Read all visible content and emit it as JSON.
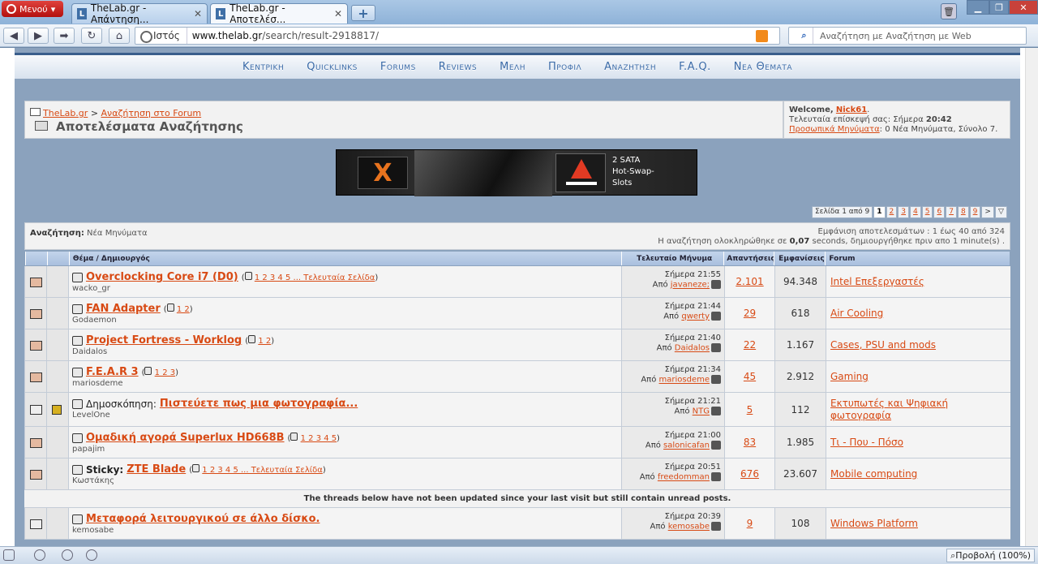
{
  "browser": {
    "menu_label": "Μενού",
    "tabs": [
      {
        "label": "TheLab.gr - Απάντηση..."
      },
      {
        "label": "TheLab.gr - Αποτελέσ..."
      }
    ],
    "address_label": "Ιστός",
    "url_host": "www.thelab.gr",
    "url_path": "/search/result-2918817/",
    "search_placeholder": "Αναζήτηση με Αναζήτηση με Web",
    "zoom": "Προβολή (100%)"
  },
  "nav": [
    "Κεντρικη",
    "Quicklinks",
    "Forums",
    "Reviews",
    "Μελη",
    "Προφιλ",
    "Αναζητηση",
    "F.A.Q.",
    "Νεα Θεματα"
  ],
  "breadcrumb": {
    "site": "TheLab.gr",
    "sep": ">",
    "section": "Αναζήτηση στο Forum",
    "title": "Αποτελέσματα Αναζήτησης"
  },
  "welcome": {
    "prefix": "Welcome,",
    "user": "Nick61",
    "suffix": ".",
    "last_visit": "Τελευταία επίσκεψή σας: Σήμερα",
    "last_time": "20:42",
    "pm_link": "Προσωπικά Μηνύματα",
    "pm_info": ": 0 Νέα Μηνύματα, Σύνολο 7."
  },
  "banner": {
    "text1": "2 SATA",
    "text2": "Hot-Swap-",
    "text3": "Slots"
  },
  "pager": {
    "label": "Σελίδα 1 από 9",
    "pages": [
      "1",
      "2",
      "3",
      "4",
      "5",
      "6",
      "7",
      "8",
      "9"
    ],
    "next": ">"
  },
  "search_info": {
    "label": "Αναζήτηση:",
    "value": "Νέα Μηνύματα",
    "line1": "Εμφάνιση αποτελεσμάτων : 1 έως 40 από 324",
    "line2a": "Η αναζήτηση ολοκληρώθηκε σε",
    "line2b": "0,07",
    "line2c": "seconds, δημιουργήθηκε πριν απο 1 minute(s) ."
  },
  "columns": {
    "topic": "Θέμα / Δημιουργός",
    "last": "Τελευταίο Μήνυμα",
    "replies": "Απαντήσεις",
    "views": "Εμφανίσεις",
    "forum": "Forum"
  },
  "rows": [
    {
      "prefix": "",
      "title": "Overclocking Core i7 (D0)",
      "pages": "1 2 3 4 5 ... Τελευταία Σελίδα",
      "author": "wacko_gr",
      "time": "Σήμερα 21:55",
      "by": "Από",
      "last_user": "javaneze;",
      "replies": "2.101",
      "views": "94.348",
      "forum": "Intel Επεξεργαστές"
    },
    {
      "prefix": "",
      "title": "FAN Adapter",
      "pages": "1 2",
      "author": "Godaemon",
      "time": "Σήμερα 21:44",
      "by": "Από",
      "last_user": "qwerty",
      "replies": "29",
      "views": "618",
      "forum": "Air Cooling"
    },
    {
      "prefix": "",
      "title": "Project Fortress - Worklog",
      "pages": "1 2",
      "author": "Daidalos",
      "time": "Σήμερα 21:40",
      "by": "Από",
      "last_user": "Daidalos",
      "replies": "22",
      "views": "1.167",
      "forum": "Cases, PSU and mods"
    },
    {
      "prefix": "",
      "title": "F.E.A.R 3",
      "pages": "1 2 3",
      "author": "mariosdeme",
      "time": "Σήμερα 21:34",
      "by": "Από",
      "last_user": "mariosdeme",
      "replies": "45",
      "views": "2.912",
      "forum": "Gaming"
    },
    {
      "prefix": "Δημοσκόπηση:",
      "title": "Πιστεύετε πως μια φωτογραφία...",
      "pages": "",
      "author": "LevelOne",
      "time": "Σήμερα 21:21",
      "by": "Από",
      "last_user": "NTG",
      "replies": "5",
      "views": "112",
      "forum": "Εκτυπωτές και Ψηφιακή φωτογραφία"
    },
    {
      "prefix": "",
      "title": "Ομαδική αγορά Superlux HD668B",
      "pages": "1 2 3 4 5",
      "author": "papajim",
      "time": "Σήμερα 21:00",
      "by": "Από",
      "last_user": "salonicafan",
      "replies": "83",
      "views": "1.985",
      "forum": "Τι - Που - Πόσο"
    },
    {
      "prefix": "Sticky:",
      "title": "ZTE Blade",
      "pages": "1 2 3 4 5 ... Τελευταία Σελίδα",
      "author": "Κωστάκης",
      "time": "Σήμερα 20:51",
      "by": "Από",
      "last_user": "freedomman",
      "replies": "676",
      "views": "23.607",
      "forum": "Mobile computing"
    }
  ],
  "separator": "The threads below have not been updated since your last visit but still contain unread posts.",
  "rows2": [
    {
      "prefix": "",
      "title": "Μεταφορά λειτουργικού σε άλλο δίσκο.",
      "pages": "",
      "author": "kemosabe",
      "time": "Σήμερα 20:39",
      "by": "Από",
      "last_user": "kemosabe",
      "replies": "9",
      "views": "108",
      "forum": "Windows Platform"
    }
  ]
}
